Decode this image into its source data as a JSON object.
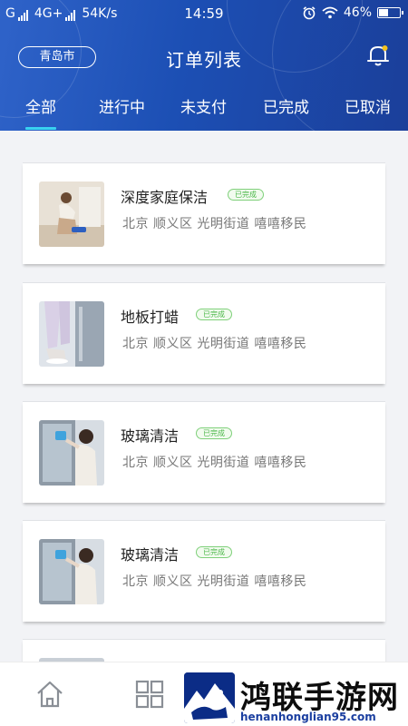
{
  "status_bar": {
    "carrier": "G",
    "network": "4G+",
    "speed": "54K/s",
    "time": "14:59",
    "battery": "46%",
    "battery_level": 0.46
  },
  "header": {
    "city": "青岛市",
    "title": "订单列表",
    "bell_icon": "bell-icon"
  },
  "tabs": [
    "全部",
    "进行中",
    "未支付",
    "已完成",
    "已取消"
  ],
  "active_tab": 0,
  "colors": {
    "header_start": "#2f63c9",
    "header_end": "#1b3f9a",
    "tab_underline": "#39d2f0",
    "badge_green": "#4cb84a"
  },
  "orders": [
    {
      "title": "深度家庭保洁",
      "status": "已完成",
      "address": "北京 顺义区 光明街道  嘻嘻移民"
    },
    {
      "title": "地板打蜡",
      "status": "已完成",
      "address": "北京 顺义区 光明街道  嘻嘻移民"
    },
    {
      "title": "玻璃清洁",
      "status": "已完成",
      "address": "北京 顺义区 光明街道  嘻嘻移民"
    },
    {
      "title": "玻璃清洁",
      "status": "已完成",
      "address": "北京 顺义区 光明街道  嘻嘻移民"
    }
  ],
  "tabbar": {
    "icons": [
      "home-icon",
      "grid-icon"
    ]
  },
  "watermark": {
    "text": "鸿联手游网",
    "url": "henanhonglian95.com"
  }
}
